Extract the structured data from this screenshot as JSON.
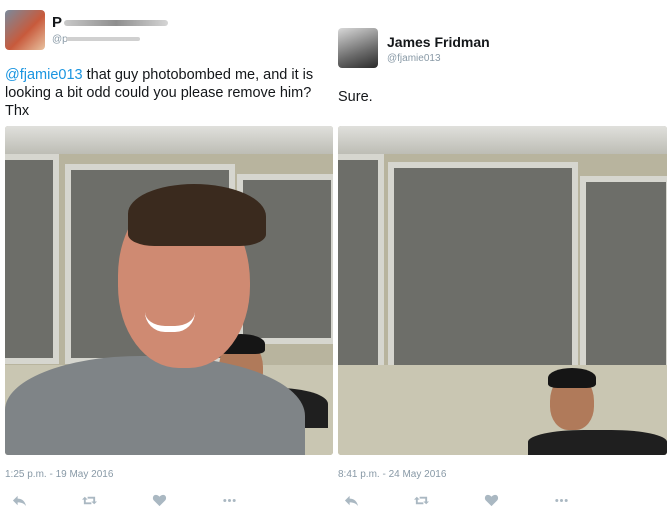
{
  "left_tweet": {
    "author_initial": "P",
    "handle_prefix": "@p",
    "mention": "@fjamie013",
    "text_line1_rest": " that guy photobombed me, and it is",
    "text_line2": "looking a bit odd could you please remove him?",
    "text_line3": "Thx",
    "timestamp": "1:25 p.m. - 19 May 2016"
  },
  "right_tweet": {
    "author_name": "James Fridman",
    "handle": "@fjamie013",
    "text": "Sure.",
    "timestamp": "8:41 p.m. - 24 May 2016"
  },
  "icons": {
    "reply": "reply-icon",
    "retweet": "retweet-icon",
    "like": "heart-icon",
    "more": "more-dots-icon"
  },
  "colors": {
    "mention_blue": "#1b95e0",
    "meta_gray": "#8899a6",
    "action_gray": "#aab8c2"
  }
}
